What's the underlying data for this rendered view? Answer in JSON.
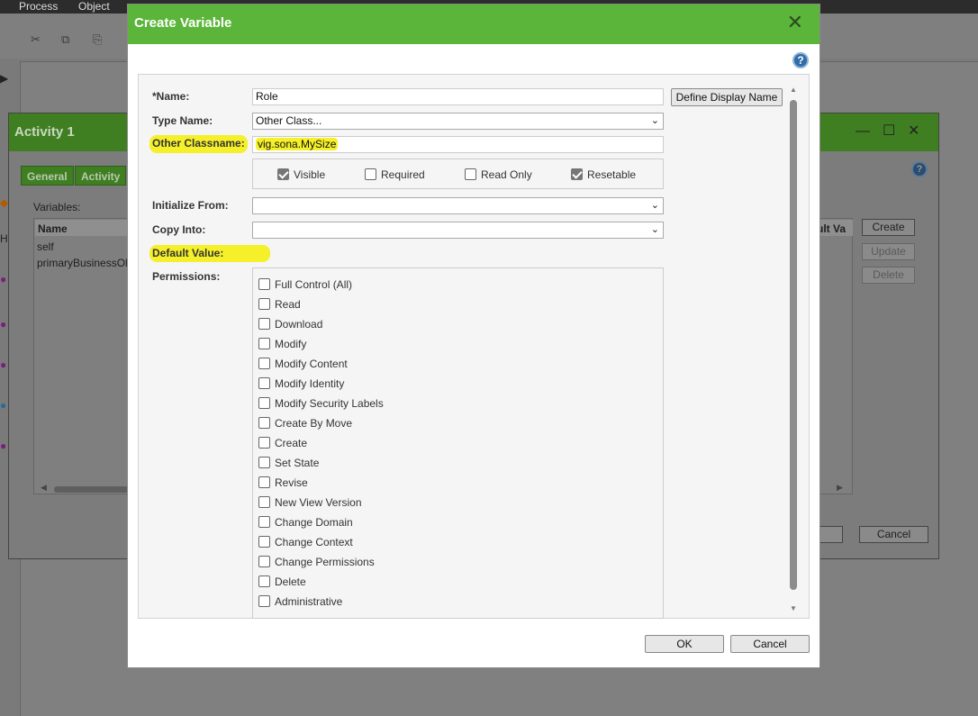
{
  "menubar": {
    "items": [
      "Process",
      "Object"
    ]
  },
  "activity": {
    "title": "Activity 1",
    "tabs": [
      "General",
      "Activity"
    ],
    "variables_label": "Variables:",
    "table": {
      "name_header": "Name",
      "right_header": "ult Va",
      "rows": [
        "self",
        "primaryBusinessOl"
      ]
    },
    "buttons": {
      "create": "Create",
      "update": "Update",
      "delete": "Delete",
      "cancel": "Cancel"
    }
  },
  "dialog": {
    "title": "Create Variable",
    "help": "?",
    "name": {
      "label": "*Name:",
      "value": "Role",
      "button": "Define Display Name"
    },
    "type_name": {
      "label": "Type Name:",
      "value": "Other Class..."
    },
    "other_classname": {
      "label": "Other Classname:",
      "value": "vig.sona.MySize"
    },
    "flags": [
      {
        "label": "Visible",
        "checked": true
      },
      {
        "label": "Required",
        "checked": false
      },
      {
        "label": "Read Only",
        "checked": false
      },
      {
        "label": "Resetable",
        "checked": true
      }
    ],
    "initialize_from": {
      "label": "Initialize From:",
      "value": ""
    },
    "copy_into": {
      "label": "Copy Into:",
      "value": ""
    },
    "default_value": {
      "label": "Default Value:"
    },
    "permissions": {
      "label": "Permissions:",
      "items": [
        "Full Control (All)",
        "Read",
        "Download",
        "Modify",
        "Modify Content",
        "Modify Identity",
        "Modify Security Labels",
        "Create By Move",
        "Create",
        "Set State",
        "Revise",
        "New View Version",
        "Change Domain",
        "Change Context",
        "Change Permissions",
        "Delete",
        "Administrative"
      ]
    },
    "ok": "OK",
    "cancel": "Cancel"
  },
  "colors": {
    "header_green": "#5bb53a",
    "highlight": "#f5f02a",
    "help_blue": "#2f6ca8"
  }
}
